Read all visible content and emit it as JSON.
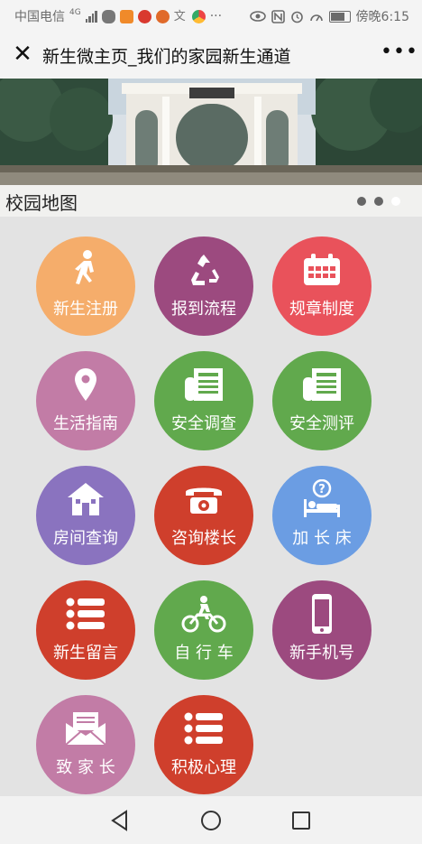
{
  "status": {
    "carrier": "中国电信",
    "network": "4G",
    "time_label": "傍晚6:15"
  },
  "header": {
    "close_icon": "close-icon",
    "title": "新生微主页_我们的家园新生通道",
    "more_icon": "more-icon"
  },
  "banner": {
    "caption": "校园地图",
    "dot_count": 3,
    "active_dot": 3
  },
  "tiles": [
    {
      "label": "新生注册",
      "icon": "walking-person-icon",
      "color": "#f5ad6b"
    },
    {
      "label": "报到流程",
      "icon": "recycle-icon",
      "color": "#9c4a7f"
    },
    {
      "label": "规章制度",
      "icon": "calendar-icon",
      "color": "#e9525b"
    },
    {
      "label": "生活指南",
      "icon": "map-pin-icon",
      "color": "#c27ca6"
    },
    {
      "label": "安全调查",
      "icon": "newspaper-icon",
      "color": "#61a94d"
    },
    {
      "label": "安全测评",
      "icon": "newspaper-icon",
      "color": "#61a94d"
    },
    {
      "label": "房间查询",
      "icon": "house-icon",
      "color": "#8a73bf"
    },
    {
      "label": "咨询楼长",
      "icon": "telephone-icon",
      "color": "#cf3f2c"
    },
    {
      "label": "加 长 床",
      "icon": "bed-icon",
      "color": "#6b9de3"
    },
    {
      "label": "新生留言",
      "icon": "list-icon",
      "color": "#cf3f2c"
    },
    {
      "label": "自 行 车",
      "icon": "motorcycle-icon",
      "color": "#61a94d"
    },
    {
      "label": "新手机号",
      "icon": "mobile-phone-icon",
      "color": "#9c4a7f"
    },
    {
      "label": "致 家 长",
      "icon": "envelope-icon",
      "color": "#c27ca6"
    },
    {
      "label": "积极心理",
      "icon": "list-icon",
      "color": "#cf3f2c"
    }
  ],
  "navbar": {
    "back_icon": "back-icon",
    "home_icon": "home-icon",
    "recents_icon": "recents-icon"
  }
}
